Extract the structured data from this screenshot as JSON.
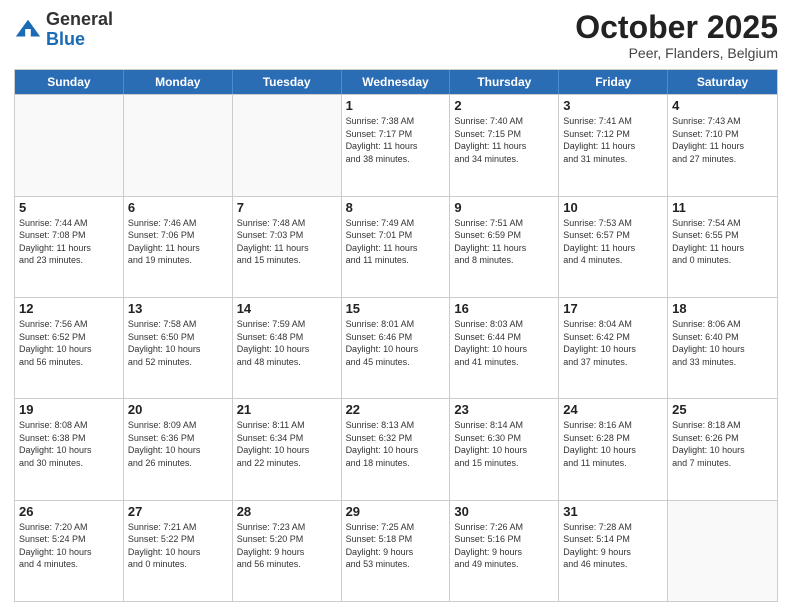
{
  "header": {
    "logo": {
      "general": "General",
      "blue": "Blue"
    },
    "month": "October 2025",
    "location": "Peer, Flanders, Belgium"
  },
  "weekdays": [
    "Sunday",
    "Monday",
    "Tuesday",
    "Wednesday",
    "Thursday",
    "Friday",
    "Saturday"
  ],
  "weeks": [
    [
      {
        "day": "",
        "info": ""
      },
      {
        "day": "",
        "info": ""
      },
      {
        "day": "",
        "info": ""
      },
      {
        "day": "1",
        "info": "Sunrise: 7:38 AM\nSunset: 7:17 PM\nDaylight: 11 hours\nand 38 minutes."
      },
      {
        "day": "2",
        "info": "Sunrise: 7:40 AM\nSunset: 7:15 PM\nDaylight: 11 hours\nand 34 minutes."
      },
      {
        "day": "3",
        "info": "Sunrise: 7:41 AM\nSunset: 7:12 PM\nDaylight: 11 hours\nand 31 minutes."
      },
      {
        "day": "4",
        "info": "Sunrise: 7:43 AM\nSunset: 7:10 PM\nDaylight: 11 hours\nand 27 minutes."
      }
    ],
    [
      {
        "day": "5",
        "info": "Sunrise: 7:44 AM\nSunset: 7:08 PM\nDaylight: 11 hours\nand 23 minutes."
      },
      {
        "day": "6",
        "info": "Sunrise: 7:46 AM\nSunset: 7:06 PM\nDaylight: 11 hours\nand 19 minutes."
      },
      {
        "day": "7",
        "info": "Sunrise: 7:48 AM\nSunset: 7:03 PM\nDaylight: 11 hours\nand 15 minutes."
      },
      {
        "day": "8",
        "info": "Sunrise: 7:49 AM\nSunset: 7:01 PM\nDaylight: 11 hours\nand 11 minutes."
      },
      {
        "day": "9",
        "info": "Sunrise: 7:51 AM\nSunset: 6:59 PM\nDaylight: 11 hours\nand 8 minutes."
      },
      {
        "day": "10",
        "info": "Sunrise: 7:53 AM\nSunset: 6:57 PM\nDaylight: 11 hours\nand 4 minutes."
      },
      {
        "day": "11",
        "info": "Sunrise: 7:54 AM\nSunset: 6:55 PM\nDaylight: 11 hours\nand 0 minutes."
      }
    ],
    [
      {
        "day": "12",
        "info": "Sunrise: 7:56 AM\nSunset: 6:52 PM\nDaylight: 10 hours\nand 56 minutes."
      },
      {
        "day": "13",
        "info": "Sunrise: 7:58 AM\nSunset: 6:50 PM\nDaylight: 10 hours\nand 52 minutes."
      },
      {
        "day": "14",
        "info": "Sunrise: 7:59 AM\nSunset: 6:48 PM\nDaylight: 10 hours\nand 48 minutes."
      },
      {
        "day": "15",
        "info": "Sunrise: 8:01 AM\nSunset: 6:46 PM\nDaylight: 10 hours\nand 45 minutes."
      },
      {
        "day": "16",
        "info": "Sunrise: 8:03 AM\nSunset: 6:44 PM\nDaylight: 10 hours\nand 41 minutes."
      },
      {
        "day": "17",
        "info": "Sunrise: 8:04 AM\nSunset: 6:42 PM\nDaylight: 10 hours\nand 37 minutes."
      },
      {
        "day": "18",
        "info": "Sunrise: 8:06 AM\nSunset: 6:40 PM\nDaylight: 10 hours\nand 33 minutes."
      }
    ],
    [
      {
        "day": "19",
        "info": "Sunrise: 8:08 AM\nSunset: 6:38 PM\nDaylight: 10 hours\nand 30 minutes."
      },
      {
        "day": "20",
        "info": "Sunrise: 8:09 AM\nSunset: 6:36 PM\nDaylight: 10 hours\nand 26 minutes."
      },
      {
        "day": "21",
        "info": "Sunrise: 8:11 AM\nSunset: 6:34 PM\nDaylight: 10 hours\nand 22 minutes."
      },
      {
        "day": "22",
        "info": "Sunrise: 8:13 AM\nSunset: 6:32 PM\nDaylight: 10 hours\nand 18 minutes."
      },
      {
        "day": "23",
        "info": "Sunrise: 8:14 AM\nSunset: 6:30 PM\nDaylight: 10 hours\nand 15 minutes."
      },
      {
        "day": "24",
        "info": "Sunrise: 8:16 AM\nSunset: 6:28 PM\nDaylight: 10 hours\nand 11 minutes."
      },
      {
        "day": "25",
        "info": "Sunrise: 8:18 AM\nSunset: 6:26 PM\nDaylight: 10 hours\nand 7 minutes."
      }
    ],
    [
      {
        "day": "26",
        "info": "Sunrise: 7:20 AM\nSunset: 5:24 PM\nDaylight: 10 hours\nand 4 minutes."
      },
      {
        "day": "27",
        "info": "Sunrise: 7:21 AM\nSunset: 5:22 PM\nDaylight: 10 hours\nand 0 minutes."
      },
      {
        "day": "28",
        "info": "Sunrise: 7:23 AM\nSunset: 5:20 PM\nDaylight: 9 hours\nand 56 minutes."
      },
      {
        "day": "29",
        "info": "Sunrise: 7:25 AM\nSunset: 5:18 PM\nDaylight: 9 hours\nand 53 minutes."
      },
      {
        "day": "30",
        "info": "Sunrise: 7:26 AM\nSunset: 5:16 PM\nDaylight: 9 hours\nand 49 minutes."
      },
      {
        "day": "31",
        "info": "Sunrise: 7:28 AM\nSunset: 5:14 PM\nDaylight: 9 hours\nand 46 minutes."
      },
      {
        "day": "",
        "info": ""
      }
    ]
  ]
}
